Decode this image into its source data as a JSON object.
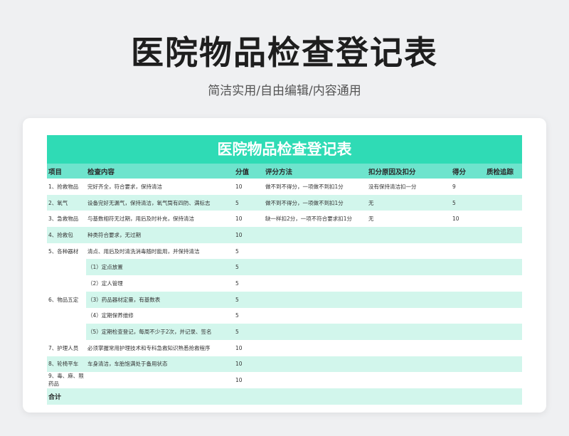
{
  "header": {
    "title": "医院物品检查登记表",
    "subtitle": "简洁实用/自由编辑/内容通用"
  },
  "sheet": {
    "title": "医院物品检查登记表",
    "columns": [
      "项目",
      "检查内容",
      "分值",
      "评分方法",
      "扣分原因及扣分",
      "得分",
      "质检追踪"
    ],
    "rows": [
      {
        "item": "1、抢救物品",
        "content": "完好齐全，符合要求，保持清洁",
        "score": "10",
        "method": "做不到不得分，一项做不到扣1分",
        "deduct": "没有保持清洁扣一分",
        "got": "9",
        "track": ""
      },
      {
        "item": "2、氧气",
        "content": "设备完好无漏气，保持清洁，氧气筒有四防、满标志",
        "score": "5",
        "method": "做不到不得分，一项做不到扣1分",
        "deduct": "无",
        "got": "5",
        "track": ""
      },
      {
        "item": "3、急救物品",
        "content": "与基数相符无过期，用后及时补充，保持清洁",
        "score": "10",
        "method": "缺一样扣2分，一项不符合要求扣1分",
        "deduct": "无",
        "got": "10",
        "track": ""
      },
      {
        "item": "4、抢救包",
        "content": "种类符合要求，无过期",
        "score": "10",
        "method": "",
        "deduct": "",
        "got": "",
        "track": ""
      },
      {
        "item": "5、各种器材",
        "content": "清点、用后及时清洗消毒随时能用，并保持清洁",
        "score": "5",
        "method": "",
        "deduct": "",
        "got": "",
        "track": ""
      },
      {
        "item": "",
        "content": "（1）定点放置",
        "score": "5",
        "method": "",
        "deduct": "",
        "got": "",
        "track": ""
      },
      {
        "item": "",
        "content": "（2）定人管理",
        "score": "5",
        "method": "",
        "deduct": "",
        "got": "",
        "track": ""
      },
      {
        "item": "6、物品五定",
        "content": "（3）药品器材定量，有基数表",
        "score": "5",
        "method": "",
        "deduct": "",
        "got": "",
        "track": ""
      },
      {
        "item": "",
        "content": "（4）定期保养维修",
        "score": "5",
        "method": "",
        "deduct": "",
        "got": "",
        "track": ""
      },
      {
        "item": "",
        "content": "（5）定期检查登记，每周不少于2次，并记录、签名",
        "score": "5",
        "method": "",
        "deduct": "",
        "got": "",
        "track": ""
      },
      {
        "item": "7、护理人员",
        "content": "必须掌握常用护理技术和专科急救知识熟悉抢救程序",
        "score": "10",
        "method": "",
        "deduct": "",
        "got": "",
        "track": ""
      },
      {
        "item": "8、轮椅平车",
        "content": "车身清洁，车胎饱满处于备用状态",
        "score": "10",
        "method": "",
        "deduct": "",
        "got": "",
        "track": ""
      },
      {
        "item": "9、毒、麻、限药品",
        "content": "",
        "score": "10",
        "method": "",
        "deduct": "",
        "got": "",
        "track": ""
      }
    ],
    "total_label": "合计"
  }
}
